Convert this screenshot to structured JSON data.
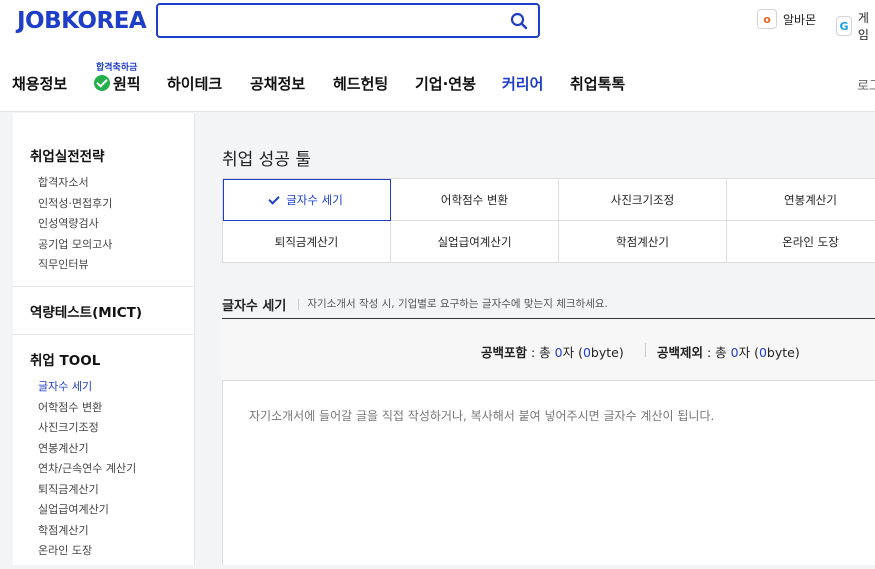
{
  "header": {
    "logo": "JOBKOREA",
    "search": {
      "placeholder": "",
      "value": ""
    },
    "utils": [
      {
        "badge": "o",
        "label": "알바몬",
        "color": "#f26522"
      },
      {
        "badge": "G",
        "label": "게임",
        "color": "#1ba1e2"
      }
    ],
    "login": "로그"
  },
  "nav": {
    "items": [
      "채용정보",
      "원픽",
      "하이테크",
      "공채정보",
      "헤드헌팅",
      "기업·연봉",
      "커리어",
      "취업톡톡"
    ],
    "wonpick_badge": "합격축하금",
    "active_index": 6
  },
  "sidebar": {
    "sections": [
      {
        "title": "취업실전전략",
        "links": [
          "합격자소서",
          "인적성·면접후기",
          "인성역량검사",
          "공기업 모의고사",
          "직무인터뷰"
        ]
      },
      {
        "title": "역량테스트(MICT)",
        "links": []
      },
      {
        "title": "취업 TOOL",
        "links": [
          "글자수 세기",
          "어학점수 변환",
          "사진크기조정",
          "연봉계산기",
          "연차/근속연수 계산기",
          "퇴직금계산기",
          "실업급여계산기",
          "학점계산기",
          "온라인 도장"
        ],
        "active": 0
      }
    ]
  },
  "main": {
    "title": "취업 성공 툴",
    "tools_row1": [
      "글자수 세기",
      "어학점수 변환",
      "사진크기조정",
      "연봉계산기"
    ],
    "tools_row2": [
      "퇴직금계산기",
      "실업급여계산기",
      "학점계산기",
      "온라인 도장"
    ],
    "section_title": "글자수 세기",
    "section_desc": "자기소개서 작성 시, 기업별로 요구하는 글자수에 맞는지 체크하세요.",
    "count_with_space": {
      "label": "공백포함",
      "pre": " : 총 ",
      "chars": "0",
      "mid": "자 (",
      "bytes": "0",
      "post": "byte)"
    },
    "count_without_space": {
      "label": "공백제외",
      "pre": " : 총 ",
      "chars": "0",
      "mid": "자 (",
      "bytes": "0",
      "post": "byte)"
    },
    "textarea_placeholder": "자기소개서에 들어갈 글을 직접 작성하거나, 복사해서 붙여 넣어주시면 글자수 계산이 됩니다."
  },
  "colors": {
    "brand": "#1e3ec7",
    "check": "#23b04b"
  }
}
